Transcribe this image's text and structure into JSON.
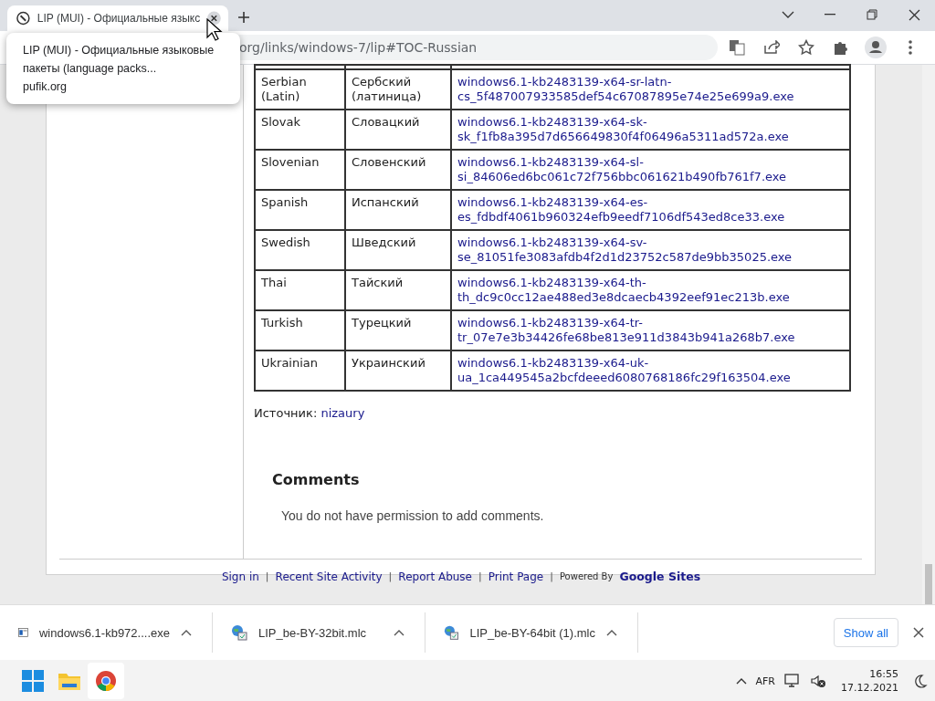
{
  "browser": {
    "tab": {
      "title": "LIP (MUI) - Официальные языкс",
      "selected": true
    },
    "tooltip": {
      "title": "LIP (MUI) - Официальные языковые пакеты (language packs...",
      "site": "pufik.org"
    },
    "address": "org/links/windows-7/lip#TOC-Russian"
  },
  "table": {
    "rows": [
      {
        "english": "Serbian (Latin)",
        "russian": "Сербский (латиница)",
        "file": "windows6.1-kb2483139-x64-sr-latn-cs_5f487007933585def54c67087895e74e25e699a9.exe"
      },
      {
        "english": "Slovak",
        "russian": "Словацкий",
        "file": "windows6.1-kb2483139-x64-sk-sk_f1fb8a395d7d656649830f4f06496a5311ad572a.exe"
      },
      {
        "english": "Slovenian",
        "russian": "Словенский",
        "file": "windows6.1-kb2483139-x64-sl-si_84606ed6bc061c72f756bbc061621b490fb761f7.exe"
      },
      {
        "english": "Spanish",
        "russian": "Испанский",
        "file": "windows6.1-kb2483139-x64-es-es_fdbdf4061b960324efb9eedf7106df543ed8ce33.exe"
      },
      {
        "english": "Swedish",
        "russian": "Шведский",
        "file": "windows6.1-kb2483139-x64-sv-se_81051fe3083afdb4f2d1d23752c587de9bb35025.exe"
      },
      {
        "english": "Thai",
        "russian": "Тайский",
        "file": "windows6.1-kb2483139-x64-th-th_dc9c0cc12ae488ed3e8dcaecb4392eef91ec213b.exe"
      },
      {
        "english": "Turkish",
        "russian": "Турецкий",
        "file": "windows6.1-kb2483139-x64-tr-tr_07e7e3b34426fe68be813e911d3843b941a268b7.exe"
      },
      {
        "english": "Ukrainian",
        "russian": "Украинский",
        "file": "windows6.1-kb2483139-x64-uk-ua_1ca449545a2bcfdeeed6080768186fc29f163504.exe"
      }
    ]
  },
  "source": {
    "label": "Источник:",
    "link": "nizaury"
  },
  "comments": {
    "title": "Comments",
    "note": "You do not have permission to add comments."
  },
  "footer": {
    "items": [
      {
        "kind": "link",
        "text": "Sign in"
      },
      {
        "kind": "separator",
        "text": "|"
      },
      {
        "kind": "link",
        "text": "Recent Site Activity"
      },
      {
        "kind": "separator",
        "text": "|"
      },
      {
        "kind": "link",
        "text": "Report Abuse"
      },
      {
        "kind": "separator",
        "text": "|"
      },
      {
        "kind": "link",
        "text": "Print Page"
      },
      {
        "kind": "separator",
        "text": "|"
      },
      {
        "kind": "label",
        "text": "Powered By"
      },
      {
        "kind": "brand",
        "text": "Google Sites"
      }
    ]
  },
  "downloads": {
    "items": [
      {
        "name": "windows6.1-kb972....exe",
        "kind": "exe"
      },
      {
        "name": "LIP_be-BY-32bit.mlc",
        "kind": "mlc"
      },
      {
        "name": "LIP_be-BY-64bit (1).mlc",
        "kind": "mlc"
      }
    ],
    "show_all": "Show all"
  },
  "taskbar": {
    "language": "AFR",
    "time": "16:55",
    "date": "17.12.2021"
  }
}
